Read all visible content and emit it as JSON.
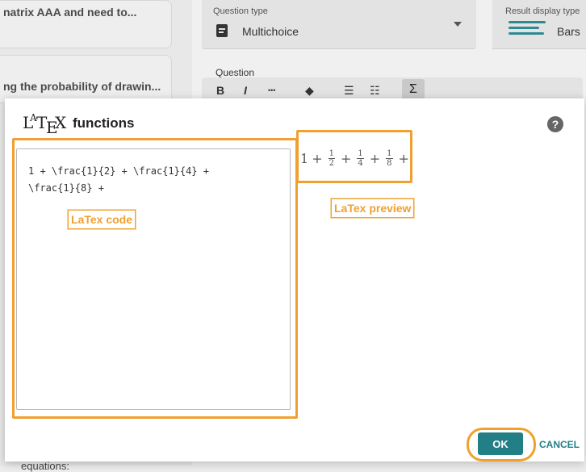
{
  "background": {
    "cards": [
      {
        "text": "natrix AAA and need to..."
      },
      {
        "text": "ng the probability of drawin..."
      }
    ],
    "question_type": {
      "label": "Question type",
      "value": "Multichoice"
    },
    "result_display": {
      "label": "Result display type",
      "value": "Bars"
    },
    "question_label": "Question",
    "toolbar": {
      "bold": "B",
      "italic": "I",
      "more": "•••",
      "fill": "◆",
      "bullets": "☰",
      "numbered": "☷",
      "sigma": "Σ"
    },
    "bottom_text": "equations:"
  },
  "modal": {
    "logo": {
      "l": "L",
      "a": "A",
      "t": "T",
      "e": "E",
      "x": "X"
    },
    "title": "functions",
    "help": "?",
    "code": "1 + \\frac{1}{2} + \\frac{1}{4} +\n\\frac{1}{8} +",
    "preview": {
      "lead": "1",
      "plus": "+",
      "fractions": [
        {
          "num": "1",
          "den": "2"
        },
        {
          "num": "1",
          "den": "4"
        },
        {
          "num": "1",
          "den": "8"
        }
      ]
    },
    "annotations": {
      "code": "LaTex code",
      "preview": "LaTex preview"
    },
    "ok": "OK",
    "cancel": "CANCEL"
  },
  "colors": {
    "accent": "#237f86",
    "highlight": "#f0a030"
  }
}
